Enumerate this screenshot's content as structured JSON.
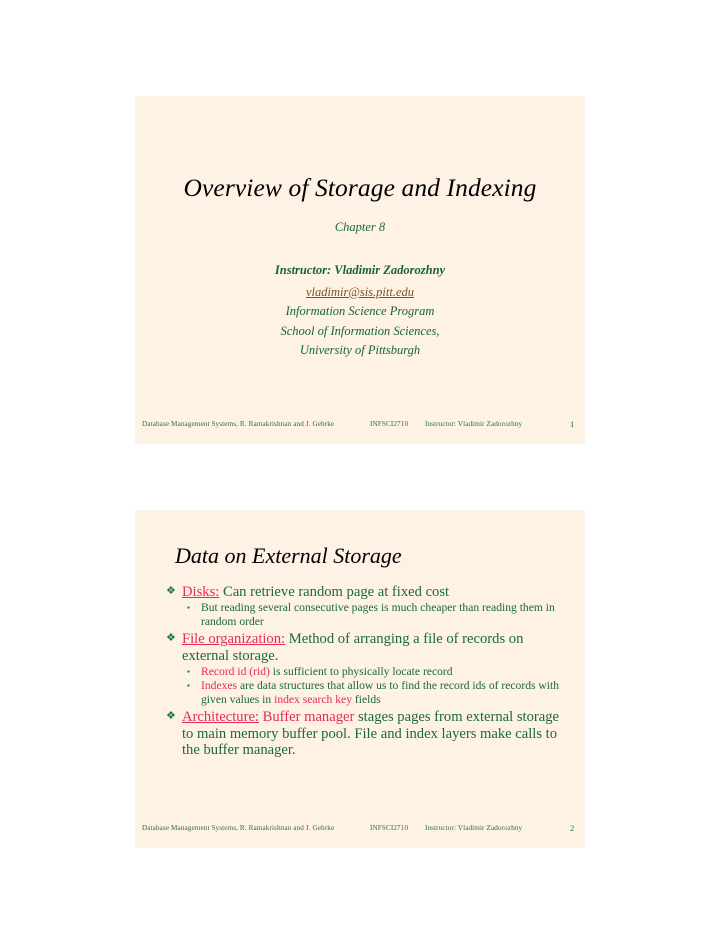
{
  "document": {
    "type": "lecture-slides",
    "slide_count": 2,
    "background": "#ffffff",
    "slide_background": "#fdf2e4",
    "accent_keyword_color": "#e62c4f",
    "body_text_color": "#1a6b33",
    "title_color": "#000000",
    "link_color": "#7a5326"
  },
  "slide1": {
    "title": "Overview of Storage and Indexing",
    "chapter": "Chapter 8",
    "instructor_name": "Instructor: Vladimir Zadorozhny",
    "instructor_email": "vladimir@sis.pitt.edu",
    "affiliation_lines": [
      "Information Science Program",
      "School of Information Sciences,",
      "University of Pittsburgh"
    ],
    "footer": {
      "source": "Database Management Systems, R. Ramakrishnan and J. Gehrke",
      "course_code": "INFSCI2710",
      "instructor": "Instructor: Vladimir Zadorozhny",
      "page_number": "1"
    }
  },
  "slide2": {
    "title": "Data on External Storage",
    "bullet_glyph": "❖",
    "sub_bullet_glyph": "▪",
    "bullets": [
      {
        "keyword": "Disks:",
        "keyword_underline": true,
        "text": " Can retrieve random page at fixed cost",
        "subs": [
          {
            "parts": [
              {
                "text": "But reading several consecutive pages is much cheaper than reading them in random order",
                "style": "normal"
              }
            ]
          }
        ]
      },
      {
        "keyword": "File organization:",
        "keyword_underline": true,
        "text": " Method of arranging a file of records on external storage.",
        "subs": [
          {
            "parts": [
              {
                "text": "Record id (rid)",
                "style": "keyword"
              },
              {
                "text": " is sufficient to physically locate record",
                "style": "normal"
              }
            ]
          },
          {
            "parts": [
              {
                "text": "Indexes",
                "style": "keyword"
              },
              {
                "text": " are data structures that allow us to find the record ids of records with given values in ",
                "style": "normal"
              },
              {
                "text": "index search key",
                "style": "keyword"
              },
              {
                "text": " fields",
                "style": "normal"
              }
            ]
          }
        ]
      },
      {
        "keyword": "Architecture:",
        "keyword_underline": true,
        "keyword2": " Buffer manager",
        "text": " stages pages from external storage to main memory buffer pool. File and index layers make calls to the buffer manager.",
        "subs": []
      }
    ],
    "footer": {
      "source": "Database Management Systems, R. Ramakrishnan and J. Gehrke",
      "course_code": "INFSCI2710",
      "instructor": "Instructor: Vladimir Zadorozhny",
      "page_number": "2"
    }
  }
}
